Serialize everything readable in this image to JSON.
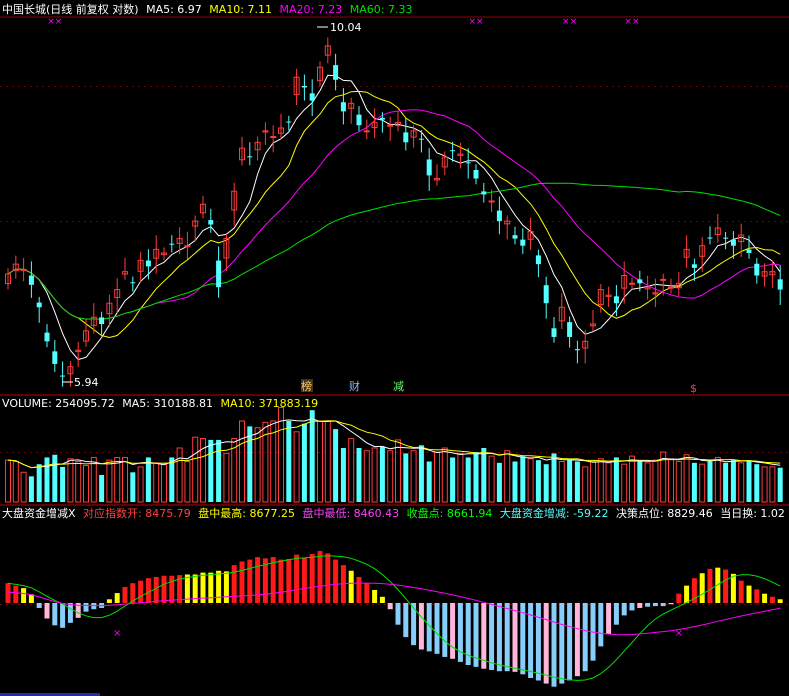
{
  "price_header": {
    "title": "中国长城(日线 前复权 对数)",
    "ma5": "MA5: 6.97",
    "ma10": "MA10: 7.11",
    "ma20": "MA20: 7.23",
    "ma60": "MA60: 7.33"
  },
  "volume_header": {
    "volume": "VOLUME: 254095.72",
    "ma5": "MA5: 310188.81",
    "ma10": "MA10: 371883.19"
  },
  "indicator_header": {
    "name": "大盘资金增减X",
    "idx_open": "对应指数开: 8475.79",
    "idx_high": "盘中最高: 8677.25",
    "idx_low": "盘中最低: 8460.43",
    "idx_close": "收盘点: 8661.94",
    "fund_change": "大盘资金增减: -59.22",
    "decision": "决策点位: 8829.46",
    "turnover": "当日换: 1.02"
  },
  "markers": {
    "high_label": "10.04",
    "low_label": "5.94",
    "tag_rank": "榜",
    "tag_fin": "财",
    "tag_reduce": "减",
    "tag_s": "$"
  },
  "colors": {
    "up": "#ff3b3b",
    "down": "#54ffff",
    "ma5": "#ffffff",
    "ma10": "#ffff00",
    "ma20": "#ff00ff",
    "ma60": "#00e000",
    "grid": "#b00000",
    "hist_red": "#ff1a1a",
    "hist_yellow": "#ffff00",
    "hist_blue": "#87cefa",
    "hist_pink": "#ffb6d9"
  },
  "chart_data": {
    "type": "candlestick",
    "closes": [
      6.22,
      6.35,
      6.28,
      6.08,
      5.8,
      5.4,
      5.15,
      5.02,
      5.12,
      5.3,
      5.52,
      5.68,
      5.6,
      5.85,
      6.02,
      6.25,
      6.1,
      6.4,
      6.32,
      6.55,
      6.5,
      6.62,
      6.7,
      6.6,
      6.95,
      7.2,
      6.9,
      6.05,
      6.7,
      7.4,
      8.1,
      7.95,
      8.2,
      8.4,
      8.3,
      8.45,
      8.55,
      9.4,
      9.2,
      8.95,
      9.6,
      10.04,
      9.35,
      8.75,
      8.9,
      8.5,
      8.4,
      8.55,
      8.6,
      8.5,
      8.55,
      8.2,
      8.4,
      8.25,
      7.65,
      7.6,
      7.95,
      8.05,
      8.0,
      7.85,
      7.6,
      7.35,
      7.25,
      6.95,
      6.95,
      6.7,
      6.6,
      6.8,
      6.35,
      5.85,
      5.45,
      5.8,
      5.45,
      5.3,
      5.4,
      5.6,
      6.02,
      5.95,
      5.85,
      6.2,
      6.1,
      6.1,
      6.05,
      5.98,
      6.15,
      6.05,
      6.1,
      6.55,
      6.3,
      6.6,
      6.7,
      6.85,
      6.7,
      6.6,
      6.75,
      6.5,
      6.2,
      6.25,
      6.25,
      6.02
    ],
    "high_value": 10.04,
    "low_value": 5.94,
    "volume": [
      310,
      300,
      220,
      190,
      280,
      330,
      350,
      260,
      320,
      300,
      270,
      330,
      200,
      310,
      330,
      330,
      220,
      260,
      330,
      290,
      280,
      330,
      400,
      300,
      480,
      470,
      460,
      460,
      360,
      470,
      600,
      560,
      550,
      590,
      600,
      700,
      600,
      520,
      580,
      680,
      600,
      600,
      540,
      400,
      470,
      400,
      380,
      400,
      410,
      380,
      460,
      360,
      380,
      420,
      300,
      370,
      400,
      330,
      360,
      330,
      370,
      400,
      340,
      290,
      380,
      300,
      340,
      320,
      310,
      280,
      360,
      300,
      310,
      300,
      260,
      300,
      320,
      290,
      330,
      280,
      340,
      300,
      290,
      310,
      370,
      320,
      300,
      350,
      290,
      280,
      300,
      330,
      290,
      310,
      290,
      310,
      280,
      260,
      260,
      254
    ],
    "vol_ma5": 310188.81,
    "vol_ma10": 371883.19,
    "fund_flow": [
      3.2,
      2.8,
      2.4,
      1.4,
      -0.8,
      -2.5,
      -3.6,
      -4.0,
      -3.2,
      -2.4,
      -1.4,
      -1.0,
      -0.8,
      0.6,
      1.6,
      2.6,
      3.2,
      3.6,
      4.0,
      4.2,
      4.4,
      4.4,
      4.5,
      4.6,
      4.6,
      4.9,
      4.9,
      5.2,
      5.1,
      6.1,
      6.7,
      7.0,
      7.4,
      7.2,
      7.4,
      7.0,
      7.1,
      7.8,
      7.3,
      7.9,
      8.4,
      8.0,
      7.0,
      6.1,
      5.2,
      4.2,
      3.2,
      2.1,
      1.0,
      -1.0,
      -3.5,
      -5.5,
      -6.8,
      -7.5,
      -7.8,
      -8.2,
      -8.7,
      -9.0,
      -9.5,
      -10.0,
      -10.3,
      -10.6,
      -10.8,
      -11.0,
      -11.0,
      -11.1,
      -11.5,
      -12.1,
      -12.5,
      -13.0,
      -13.5,
      -13.0,
      -12.5,
      -11.8,
      -11.0,
      -9.3,
      -7.0,
      -5.0,
      -3.5,
      -2.0,
      -1.2,
      -0.8,
      -0.6,
      -0.5,
      -0.5,
      -0.2,
      1.5,
      2.8,
      4.0,
      4.8,
      5.5,
      5.7,
      5.4,
      4.7,
      3.6,
      2.8,
      2.2,
      1.5,
      1.0,
      0.6
    ]
  }
}
